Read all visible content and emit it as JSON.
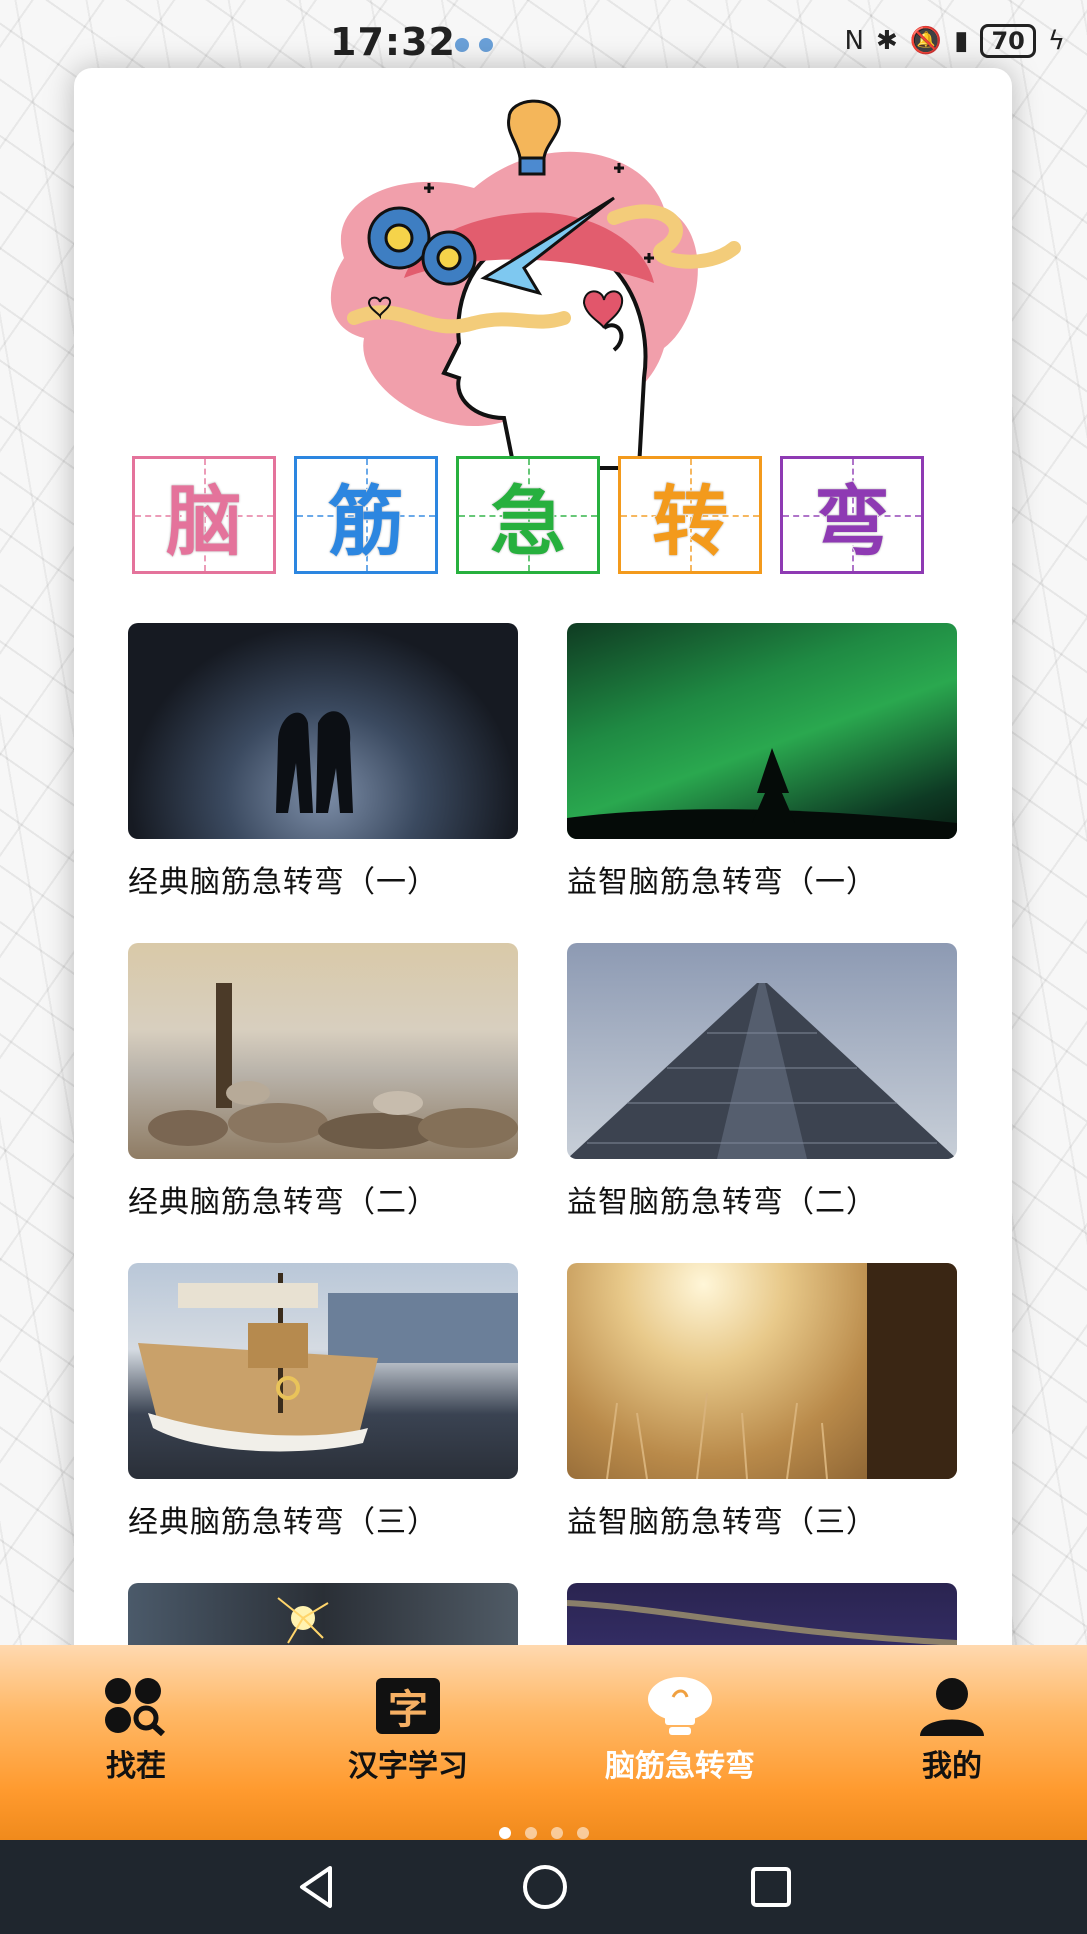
{
  "status_bar": {
    "time": "17:32",
    "battery": "70"
  },
  "header": {
    "title_chars": [
      {
        "char": "脑",
        "color": "#e4739b"
      },
      {
        "char": "筋",
        "color": "#2c86e0"
      },
      {
        "char": "急",
        "color": "#27b03e"
      },
      {
        "char": "转",
        "color": "#f39a1c"
      },
      {
        "char": "弯",
        "color": "#8e3ab3"
      }
    ]
  },
  "cards": [
    {
      "caption": "经典脑筋急转弯（一）",
      "image": "night-couple-photo"
    },
    {
      "caption": "益智脑筋急转弯（一）",
      "image": "aurora-tree-photo"
    },
    {
      "caption": "经典脑筋急转弯（二）",
      "image": "post-rocks-lake-photo"
    },
    {
      "caption": "益智脑筋急转弯（二）",
      "image": "skyscraper-photo"
    },
    {
      "caption": "经典脑筋急转弯（三）",
      "image": "sailboat-harbor-photo"
    },
    {
      "caption": "益智脑筋急转弯（三）",
      "image": "sunlit-grass-photo"
    },
    {
      "caption": "",
      "image": "sparkler-photo"
    },
    {
      "caption": "",
      "image": "bridge-night-photo"
    }
  ],
  "bottom_nav": {
    "items": [
      {
        "label": "找茬",
        "icon": "spot-difference-icon"
      },
      {
        "label": "汉字学习",
        "icon": "character-icon",
        "icon_text": "字"
      },
      {
        "label": "脑筋急转弯",
        "icon": "lightbulb-icon",
        "active": true
      },
      {
        "label": "我的",
        "icon": "user-icon"
      }
    ],
    "page_indicator": {
      "count": 4,
      "active_index": 0
    }
  }
}
